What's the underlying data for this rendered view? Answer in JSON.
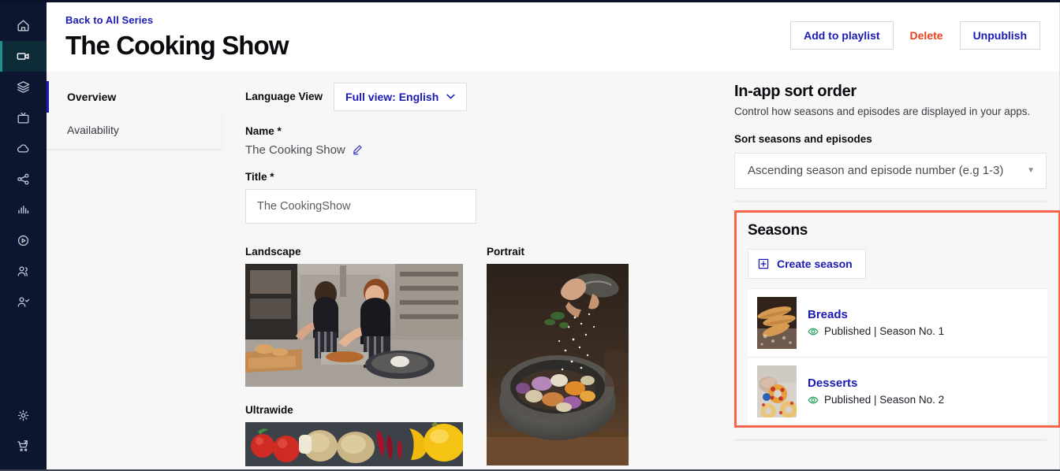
{
  "sidebar": {
    "items": [
      {
        "icon": "home-icon",
        "name": "home",
        "active": false
      },
      {
        "icon": "video-camera-icon",
        "name": "video",
        "active": true
      },
      {
        "icon": "layers-icon",
        "name": "layers",
        "active": false
      },
      {
        "icon": "tv-icon",
        "name": "tv",
        "active": false
      },
      {
        "icon": "cloud-icon",
        "name": "cloud",
        "active": false
      },
      {
        "icon": "share-icon",
        "name": "share",
        "active": false
      },
      {
        "icon": "bar-chart-icon",
        "name": "analytics",
        "active": false
      },
      {
        "icon": "play-circle-icon",
        "name": "player",
        "active": false
      },
      {
        "icon": "users-icon",
        "name": "users",
        "active": false
      },
      {
        "icon": "user-check-icon",
        "name": "user-check",
        "active": false
      }
    ],
    "bottom_items": [
      {
        "icon": "gear-icon",
        "name": "settings"
      },
      {
        "icon": "cart-icon",
        "name": "store"
      }
    ]
  },
  "header": {
    "back_link": "Back to All Series",
    "title": "The Cooking Show",
    "actions": {
      "add_to_playlist": "Add to playlist",
      "delete": "Delete",
      "unpublish": "Unpublish"
    }
  },
  "tabs": [
    {
      "label": "Overview",
      "active": true
    },
    {
      "label": "Availability",
      "active": false
    }
  ],
  "form": {
    "language_view_label": "Language View",
    "language_view_value": "Full view: English",
    "name_label": "Name *",
    "name_value": "The Cooking Show",
    "title_label": "Title *",
    "title_value": "The CookingShow",
    "title_placeholder": "The CookingShow",
    "images": {
      "landscape_label": "Landscape",
      "portrait_label": "Portrait",
      "ultrawide_label": "Ultrawide"
    }
  },
  "sort_panel": {
    "title": "In-app sort order",
    "description": "Control how seasons and episodes are displayed in your apps.",
    "field_label": "Sort seasons and episodes",
    "selected_option": "Ascending season and episode number (e.g 1-3)",
    "caret": "▼"
  },
  "seasons_panel": {
    "title": "Seasons",
    "create_label": "Create season",
    "highlight_color": "#f4664a",
    "items": [
      {
        "name": "Breads",
        "status": "Published",
        "meta": "Published | Season No. 1"
      },
      {
        "name": "Desserts",
        "status": "Published",
        "meta": "Published | Season No. 2"
      }
    ]
  },
  "colors": {
    "brand_blue": "#1a1ab5",
    "danger": "#e8411c",
    "published_green": "#139a55",
    "sidebar_navy": "#0c1631",
    "sidebar_active": "#0d2b36",
    "accent_teal": "#1d8f8f"
  }
}
